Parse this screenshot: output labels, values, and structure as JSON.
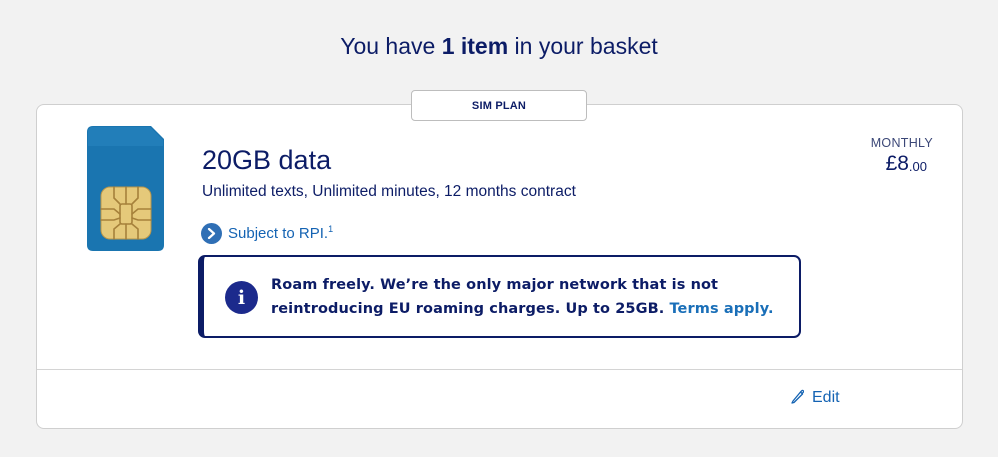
{
  "header": {
    "prefix": "You have ",
    "count": "1 item",
    "suffix": " in your basket"
  },
  "plan": {
    "tag": "SIM PLAN",
    "title": "20GB data",
    "subtitle": "Unlimited texts, Unlimited minutes, 12 months contract",
    "rpi_label": "Subject to RPI.",
    "rpi_footnote": "1"
  },
  "info": {
    "text": "Roam freely. We’re the only major network that is not reintroducing EU roaming charges. Up to 25GB. ",
    "link": "Terms apply."
  },
  "price": {
    "label": "MONTHLY",
    "main": "£8",
    "cents": ".00"
  },
  "actions": {
    "edit_label": "Edit"
  },
  "colors": {
    "navy": "#0c1c66",
    "link": "#1463b3",
    "sim_blue": "#1a75b0",
    "chip_gold": "#e5c97a"
  }
}
